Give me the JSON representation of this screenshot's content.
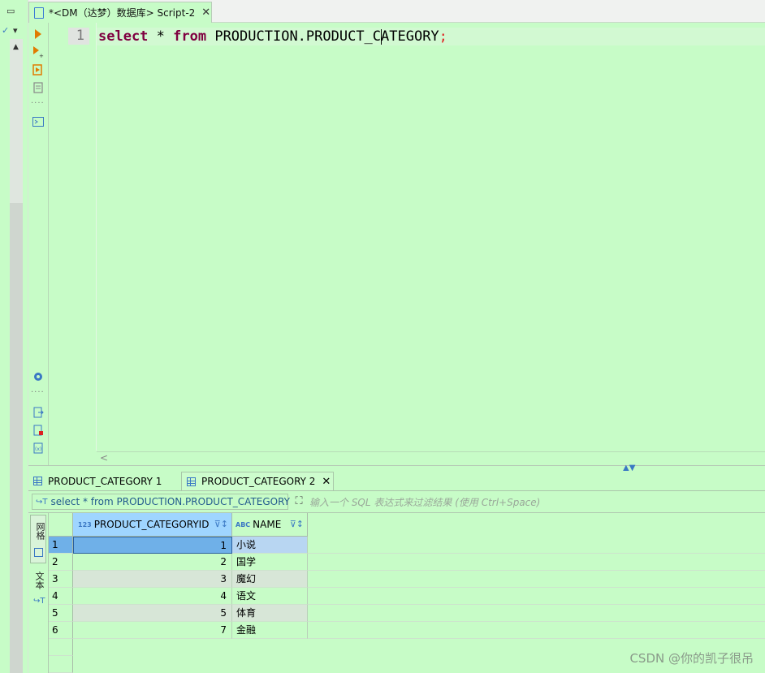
{
  "editor": {
    "tab_title": "*<DM（达梦）数据库> Script-2",
    "tab_close": "✕",
    "line_number": "1",
    "code": {
      "kw1": "select",
      "star": " * ",
      "kw2": "from",
      "table": " PRODUCTION.PRODUCT_CATEGORY",
      "semicolon": ";"
    },
    "scroll_left": "<"
  },
  "results": {
    "tabs": [
      {
        "label": "PRODUCT_CATEGORY 1"
      },
      {
        "label": "PRODUCT_CATEGORY 2",
        "close": "✕"
      }
    ],
    "query_text": "select * from PRODUCTION.PRODUCT_CATEGORY",
    "filter_placeholder": "输入一个 SQL 表达式来过滤结果 (使用 Ctrl+Space)",
    "side_tabs": {
      "grid": "网格",
      "text": "文本"
    },
    "columns": [
      {
        "type_icon": "123",
        "label": "PRODUCT_CATEGORYID"
      },
      {
        "type_icon": "ABC",
        "label": "NAME"
      }
    ],
    "rows": [
      {
        "n": "1",
        "id": "1",
        "name": "小说"
      },
      {
        "n": "2",
        "id": "2",
        "name": "国学"
      },
      {
        "n": "3",
        "id": "3",
        "name": "魔幻"
      },
      {
        "n": "4",
        "id": "4",
        "name": "语文"
      },
      {
        "n": "5",
        "id": "5",
        "name": "体育"
      },
      {
        "n": "6",
        "id": "7",
        "name": "金融"
      }
    ]
  },
  "watermark": "CSDN @你的凯子很吊"
}
